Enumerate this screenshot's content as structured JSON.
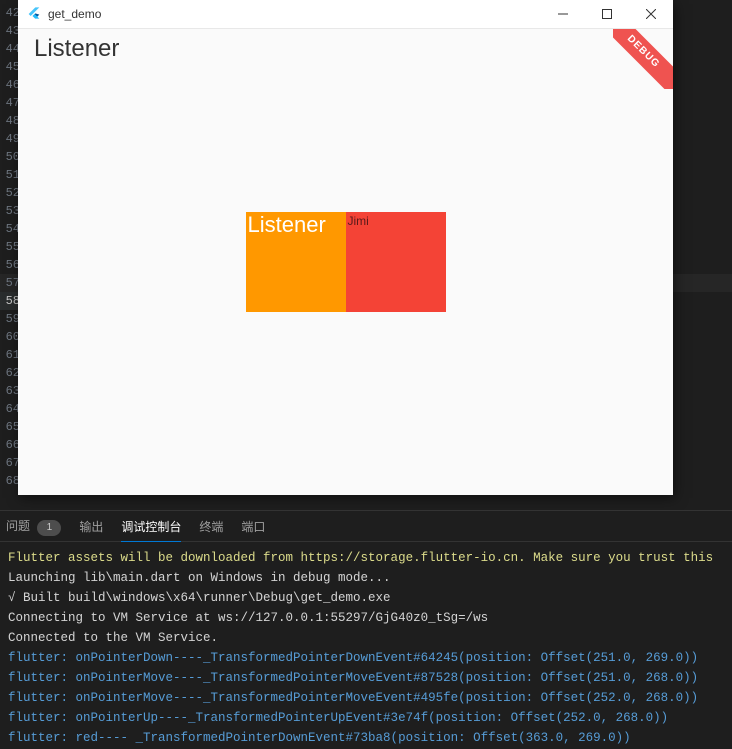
{
  "gutter": {
    "start": 42,
    "end": 68,
    "highlight": 58
  },
  "window": {
    "title": "get_demo",
    "app_label": "Listener",
    "debug_label": "DEBUG",
    "orange_label": "Listener",
    "red_label": "Jimi"
  },
  "panel": {
    "tabs": {
      "problems": "问题",
      "problems_count": "1",
      "output": "输出",
      "debug_console": "调试控制台",
      "terminal": "终端",
      "ports": "端口"
    },
    "active_tab": "debug_console",
    "lines": [
      {
        "cls": "c-yellow",
        "t": "Flutter assets will be downloaded from https://storage.flutter-io.cn. Make sure you trust this"
      },
      {
        "cls": "c-white",
        "t": "Launching lib\\main.dart on Windows in debug mode..."
      },
      {
        "cls": "c-white",
        "t": "√ Built build\\windows\\x64\\runner\\Debug\\get_demo.exe"
      },
      {
        "cls": "c-white",
        "t": "Connecting to VM Service at ws://127.0.0.1:55297/GjG40z0_tSg=/ws"
      },
      {
        "cls": "c-white",
        "t": "Connected to the VM Service."
      },
      {
        "cls": "c-blue",
        "t": "flutter: onPointerDown----_TransformedPointerDownEvent#64245(position: Offset(251.0, 269.0))"
      },
      {
        "cls": "c-blue",
        "t": "flutter: onPointerMove----_TransformedPointerMoveEvent#87528(position: Offset(251.0, 268.0))"
      },
      {
        "cls": "c-blue",
        "t": "flutter: onPointerMove----_TransformedPointerMoveEvent#495fe(position: Offset(252.0, 268.0))"
      },
      {
        "cls": "c-blue",
        "t": "flutter: onPointerUp----_TransformedPointerUpEvent#3e74f(position: Offset(252.0, 268.0))"
      },
      {
        "cls": "c-blue",
        "t": "flutter: red---- _TransformedPointerDownEvent#73ba8(position: Offset(363.0, 269.0))"
      }
    ]
  }
}
